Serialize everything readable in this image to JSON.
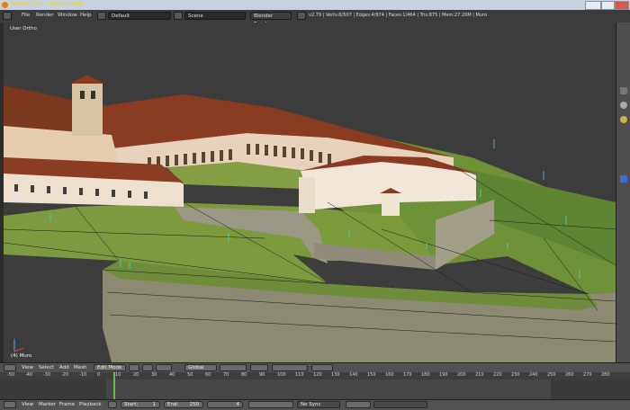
{
  "window": {
    "title": "Blender [D:\\...\\Muro.blend]"
  },
  "info_header": {
    "menus": [
      "File",
      "Render",
      "Window",
      "Help"
    ],
    "screen_layout": "Default",
    "scene": "Scene",
    "render_engine": "Blender Render",
    "stats": "v2.79 | Verts:6/507 | Edges:4/974 | Faces:1/464 | Tris:875 | Mem:27.20M | Muro"
  },
  "viewport": {
    "view_label": "User Ortho",
    "object_label": "(4) Muro"
  },
  "view3d_header": {
    "menus": [
      "View",
      "Select",
      "Add",
      "Mesh"
    ],
    "mode": "Edit Mode",
    "pivot": "Global"
  },
  "timeline": {
    "ticks": [
      "-50",
      "-40",
      "-30",
      "-20",
      "-10",
      "0",
      "10",
      "20",
      "30",
      "40",
      "50",
      "60",
      "70",
      "80",
      "90",
      "100",
      "110",
      "120",
      "130",
      "140",
      "150",
      "160",
      "170",
      "180",
      "190",
      "200",
      "210",
      "220",
      "230",
      "240",
      "250",
      "260",
      "270",
      "280"
    ],
    "current_frame_marker": 0
  },
  "timeline_header": {
    "menus": [
      "View",
      "Marker",
      "Frame",
      "Playback"
    ],
    "start_label": "Start:",
    "start_value": "1",
    "end_label": "End:",
    "end_value": "250",
    "current_frame": "4",
    "sync": "No Sync"
  }
}
